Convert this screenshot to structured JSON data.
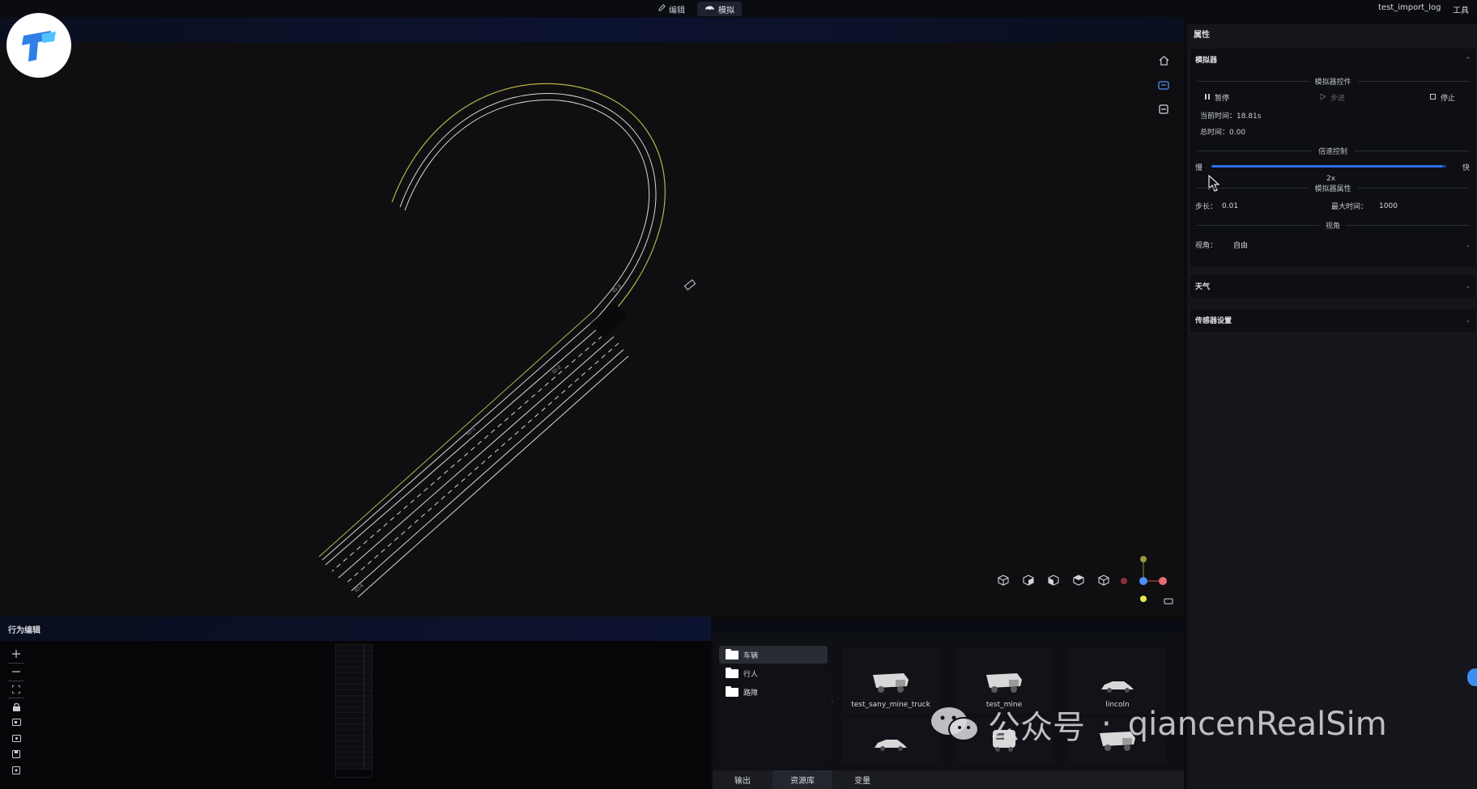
{
  "topbar": {
    "tabs": [
      {
        "label": "编辑",
        "icon": "pencil-icon",
        "active": false
      },
      {
        "label": "模拟",
        "icon": "car-icon",
        "active": true
      }
    ],
    "project_name": "test_import_log",
    "tools_label": "工具"
  },
  "viewport": {
    "tools": [
      "home-icon",
      "car-view-icon",
      "layers-icon"
    ],
    "view_cubes": [
      "cube-icon",
      "cube-front-icon",
      "cube-side-icon",
      "cube-back-icon",
      "cube-top-icon"
    ]
  },
  "right_panel": {
    "title": "属性",
    "simulator": {
      "title": "模拟器",
      "controls_label": "模拟器控件",
      "pause_label": "暂停",
      "step_label": "步进",
      "stop_label": "停止",
      "current_time_label": "当前时间：18.81s",
      "total_time_label": "总时间：0.00",
      "speed_label": "倍速控制",
      "slow_label": "慢",
      "fast_label": "快",
      "speed_value": "2x",
      "props_label": "模拟器属性",
      "step_size_label": "步长：",
      "step_size_value": "0.01",
      "max_time_label": "最大时间：",
      "max_time_value": "1000",
      "view_section_label": "视角",
      "view_label": "视角：",
      "view_value": "自由"
    },
    "weather": {
      "title": "天气"
    },
    "sensors": {
      "title": "传感器设置"
    }
  },
  "behavior": {
    "title": "行为编辑",
    "tools": [
      "plus-icon",
      "minus-icon",
      "fit-icon",
      "lock-icon",
      "camera-icon",
      "record-icon",
      "save-icon",
      "export-icon"
    ]
  },
  "resource": {
    "folders": [
      {
        "label": "车辆",
        "active": true
      },
      {
        "label": "行人",
        "active": false
      },
      {
        "label": "路障",
        "active": false
      }
    ],
    "assets": [
      {
        "label": "test_sany_mine_truck",
        "icon": "mine-truck-icon"
      },
      {
        "label": "test_mine",
        "icon": "mine-truck-icon"
      },
      {
        "label": "lincoln",
        "icon": "sedan-icon"
      },
      {
        "label": "",
        "icon": "sedan-icon"
      },
      {
        "label": "",
        "icon": "van-icon"
      },
      {
        "label": "",
        "icon": "mine-truck-icon"
      }
    ],
    "tabs": [
      {
        "label": "输出",
        "active": false
      },
      {
        "label": "资源库",
        "active": true
      },
      {
        "label": "变量",
        "active": false
      }
    ]
  },
  "watermark": {
    "text1": "公众号",
    "dot": "·",
    "text2": "qiancenRealSim"
  },
  "colors": {
    "accent": "#2a6df4",
    "road_edge": "#b7b24a",
    "road_line": "#e8e8e8",
    "panel": "#15161b"
  }
}
